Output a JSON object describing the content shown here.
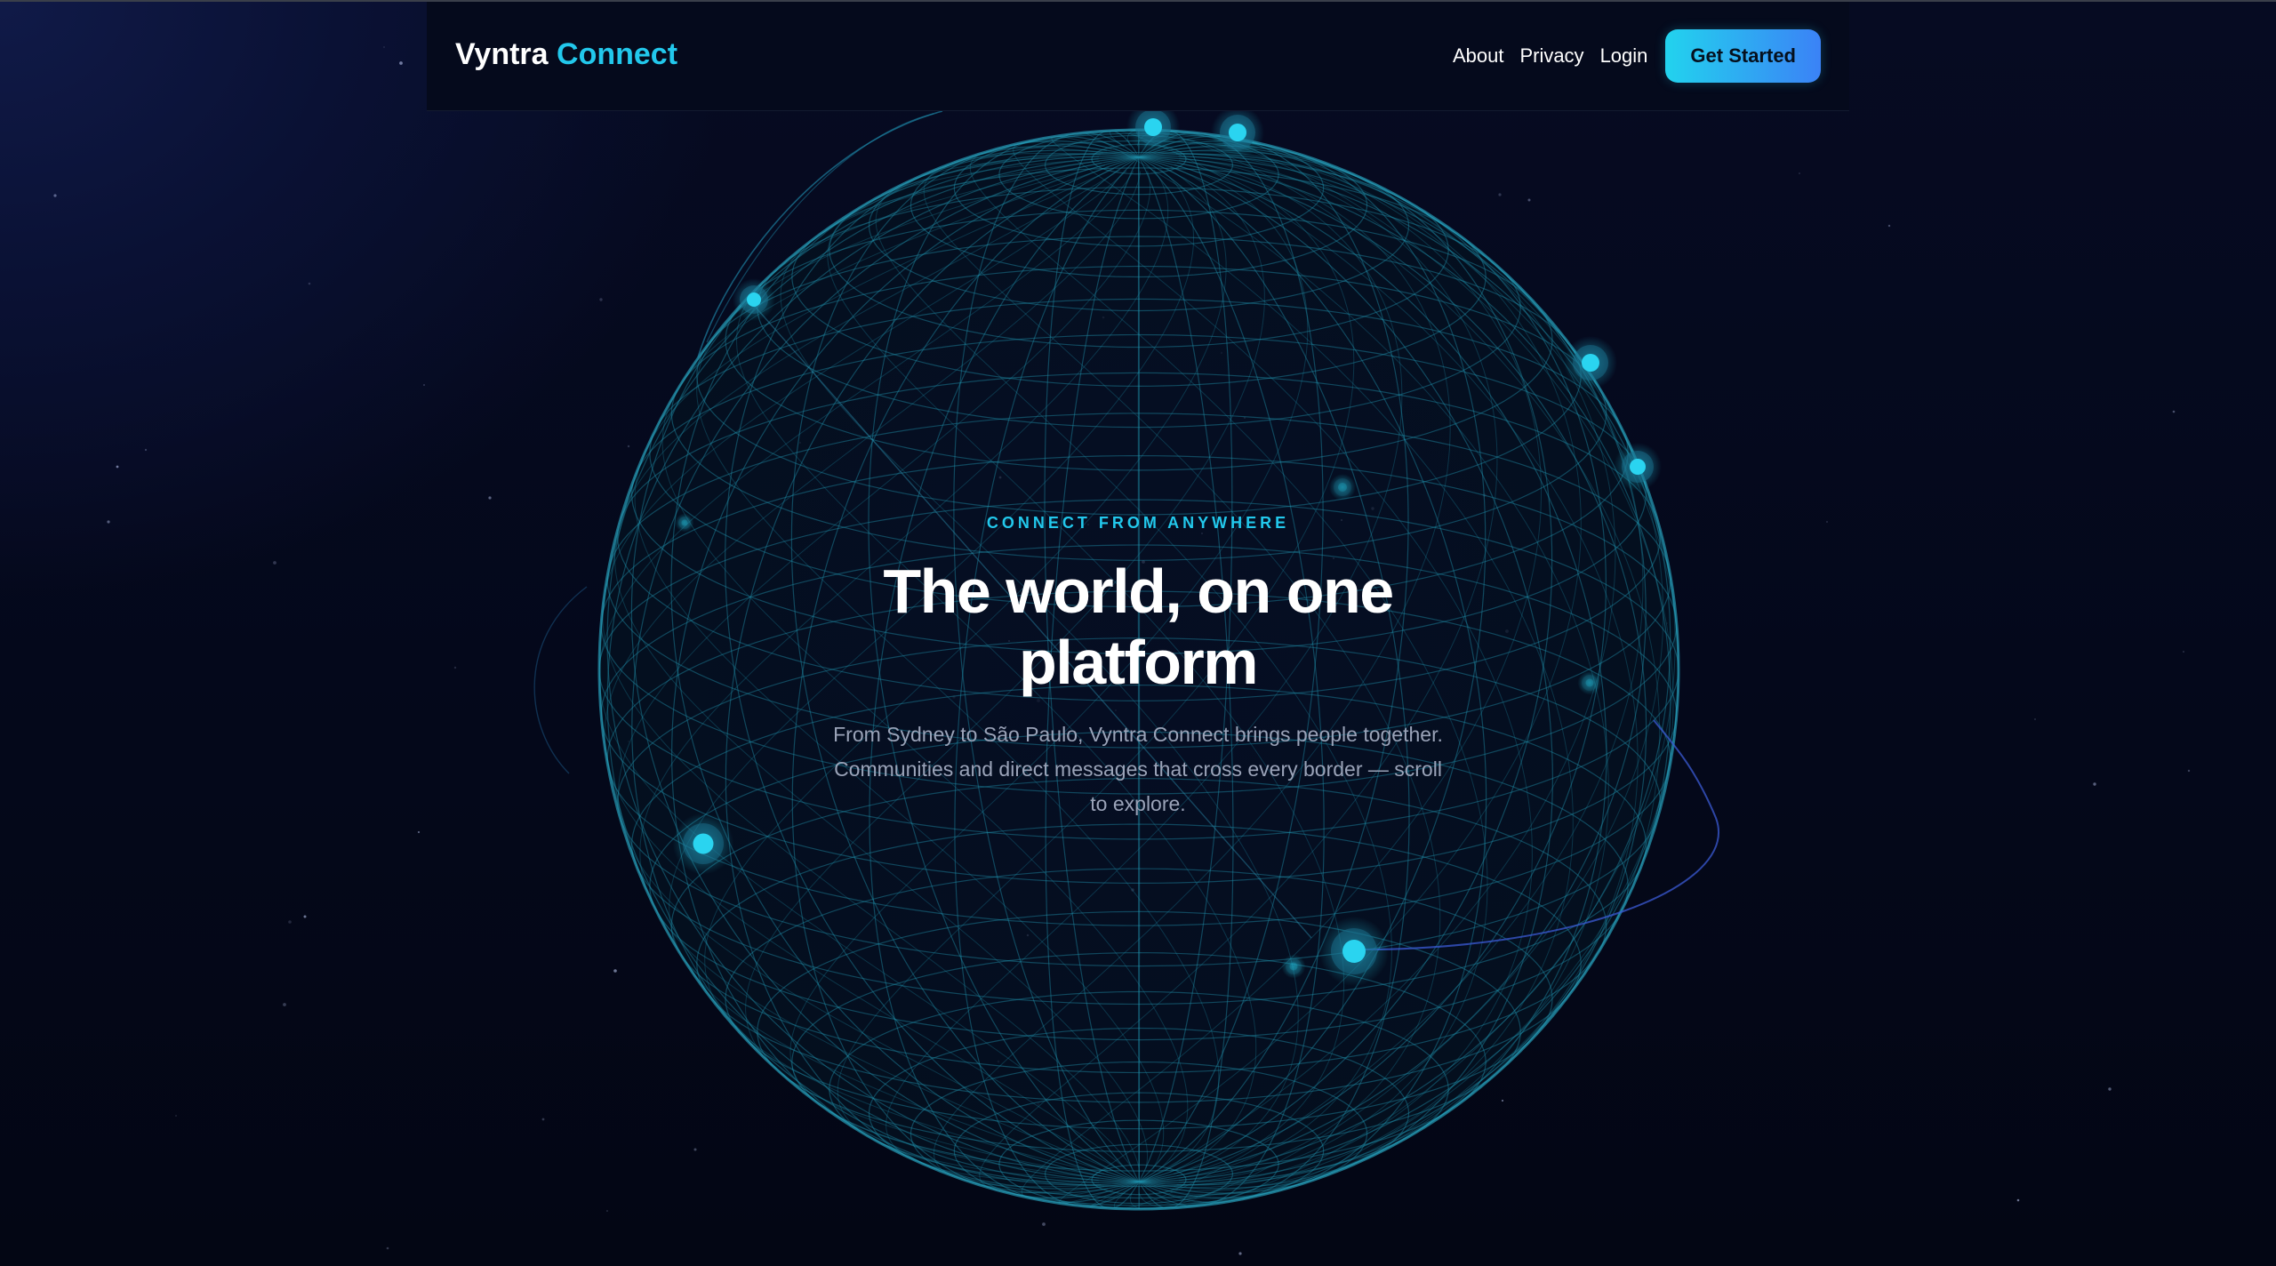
{
  "brand": {
    "name_part1": "Vyntra",
    "name_part2": "Connect"
  },
  "nav": {
    "links": [
      {
        "label": "About"
      },
      {
        "label": "Privacy"
      },
      {
        "label": "Login"
      }
    ],
    "cta_label": "Get Started"
  },
  "hero": {
    "eyebrow": "CONNECT FROM ANYWHERE",
    "headline": "The world, on one platform",
    "subtext": "From Sydney to São Paulo, Vyntra Connect brings people together. Communities and direct messages that cross every border — scroll to explore."
  },
  "colors": {
    "accent": "#22c8ec",
    "cta_gradient_start": "#22d3ee",
    "cta_gradient_end": "#3b82f6",
    "background": "#040814",
    "globe_wire": "#1f8fa8"
  },
  "icons": [
    "globe-wireframe",
    "location-node"
  ]
}
